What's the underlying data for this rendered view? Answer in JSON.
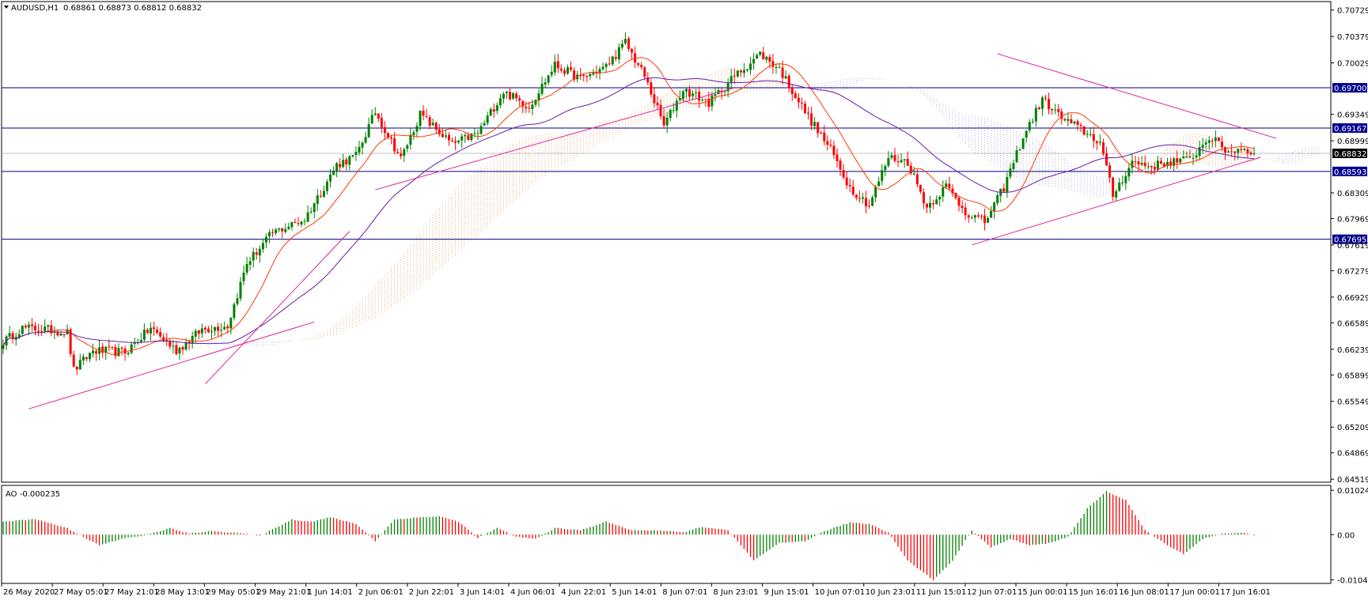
{
  "chart_data": [
    {
      "type": "candlestick",
      "symbol_label": "AUDUSD,H1",
      "ohlc_label": "0.68861 0.68873 0.68812 0.68832",
      "ylim": [
        0.645,
        0.7082
      ],
      "y_tick_labels": [
        {
          "value": 0.70729,
          "label": "0.70729"
        },
        {
          "value": 0.70379,
          "label": "0.70379"
        },
        {
          "value": 0.70029,
          "label": "0.70029"
        },
        {
          "value": 0.69349,
          "label": "0.69349"
        },
        {
          "value": 0.68999,
          "label": "0.68999"
        },
        {
          "value": 0.68309,
          "label": "0.68309"
        },
        {
          "value": 0.67969,
          "label": "0.67969"
        },
        {
          "value": 0.67619,
          "label": "0.67619"
        },
        {
          "value": 0.67279,
          "label": "0.67279"
        },
        {
          "value": 0.66929,
          "label": "0.66929"
        },
        {
          "value": 0.66589,
          "label": "0.66589"
        },
        {
          "value": 0.66239,
          "label": "0.66239"
        },
        {
          "value": 0.65899,
          "label": "0.65899"
        },
        {
          "value": 0.65549,
          "label": "0.65549"
        },
        {
          "value": 0.65209,
          "label": "0.65209"
        },
        {
          "value": 0.64869,
          "label": "0.64869"
        },
        {
          "value": 0.64519,
          "label": "0.64519"
        }
      ],
      "horizontal_levels": [
        {
          "value": 0.697,
          "label": "0.69700",
          "color": "#00008b"
        },
        {
          "value": 0.69167,
          "label": "0.69167",
          "color": "#00008b"
        },
        {
          "value": 0.68593,
          "label": "0.68593",
          "color": "#00008b"
        },
        {
          "value": 0.67695,
          "label": "0.67695",
          "color": "#00008b"
        }
      ],
      "current_price": {
        "value": 0.68832,
        "label": "0.68832"
      },
      "x_tick_labels": [
        "26 May 2020",
        "27 May 05:01",
        "27 May 21:01",
        "28 May 13:01",
        "29 May 05:01",
        "29 May 21:01",
        "1 Jun 14:01",
        "2 Jun 06:01",
        "2 Jun 22:01",
        "3 Jun 14:01",
        "4 Jun 06:01",
        "4 Jun 22:01",
        "5 Jun 14:01",
        "8 Jun 07:01",
        "8 Jun 23:01",
        "9 Jun 15:01",
        "10 Jun 07:01",
        "10 Jun 23:01",
        "11 Jun 15:01",
        "12 Jun 07:01",
        "15 Jun 00:01",
        "15 Jun 16:01",
        "16 Jun 08:01",
        "17 Jun 00:01",
        "17 Jun 16:01"
      ],
      "close_path": [
        {
          "bar": 0,
          "close": 0.6634
        },
        {
          "bar": 6,
          "close": 0.6652
        },
        {
          "bar": 14,
          "close": 0.665
        },
        {
          "bar": 20,
          "close": 0.6646
        },
        {
          "bar": 22,
          "close": 0.6596
        },
        {
          "bar": 28,
          "close": 0.6622
        },
        {
          "bar": 38,
          "close": 0.662
        },
        {
          "bar": 46,
          "close": 0.6652
        },
        {
          "bar": 54,
          "close": 0.6622
        },
        {
          "bar": 62,
          "close": 0.665
        },
        {
          "bar": 70,
          "close": 0.6655
        },
        {
          "bar": 76,
          "close": 0.6738
        },
        {
          "bar": 84,
          "close": 0.6778
        },
        {
          "bar": 94,
          "close": 0.6796
        },
        {
          "bar": 104,
          "close": 0.6868
        },
        {
          "bar": 110,
          "close": 0.688
        },
        {
          "bar": 116,
          "close": 0.6938
        },
        {
          "bar": 124,
          "close": 0.6876
        },
        {
          "bar": 130,
          "close": 0.6935
        },
        {
          "bar": 140,
          "close": 0.6895
        },
        {
          "bar": 148,
          "close": 0.691
        },
        {
          "bar": 156,
          "close": 0.6965
        },
        {
          "bar": 164,
          "close": 0.6945
        },
        {
          "bar": 172,
          "close": 0.7
        },
        {
          "bar": 180,
          "close": 0.6982
        },
        {
          "bar": 188,
          "close": 0.6998
        },
        {
          "bar": 194,
          "close": 0.703
        },
        {
          "bar": 200,
          "close": 0.6985
        },
        {
          "bar": 206,
          "close": 0.692
        },
        {
          "bar": 212,
          "close": 0.6968
        },
        {
          "bar": 220,
          "close": 0.695
        },
        {
          "bar": 228,
          "close": 0.6985
        },
        {
          "bar": 236,
          "close": 0.7015
        },
        {
          "bar": 242,
          "close": 0.6995
        },
        {
          "bar": 250,
          "close": 0.6938
        },
        {
          "bar": 258,
          "close": 0.6888
        },
        {
          "bar": 264,
          "close": 0.6838
        },
        {
          "bar": 270,
          "close": 0.6815
        },
        {
          "bar": 276,
          "close": 0.6878
        },
        {
          "bar": 282,
          "close": 0.6872
        },
        {
          "bar": 288,
          "close": 0.6812
        },
        {
          "bar": 294,
          "close": 0.684
        },
        {
          "bar": 300,
          "close": 0.6806
        },
        {
          "bar": 306,
          "close": 0.6792
        },
        {
          "bar": 312,
          "close": 0.6838
        },
        {
          "bar": 318,
          "close": 0.6905
        },
        {
          "bar": 324,
          "close": 0.6955
        },
        {
          "bar": 330,
          "close": 0.693
        },
        {
          "bar": 336,
          "close": 0.6915
        },
        {
          "bar": 342,
          "close": 0.6898
        },
        {
          "bar": 346,
          "close": 0.6828
        },
        {
          "bar": 352,
          "close": 0.6872
        },
        {
          "bar": 358,
          "close": 0.6866
        },
        {
          "bar": 364,
          "close": 0.6872
        },
        {
          "bar": 370,
          "close": 0.6875
        },
        {
          "bar": 376,
          "close": 0.6905
        },
        {
          "bar": 382,
          "close": 0.6885
        },
        {
          "bar": 386,
          "close": 0.689
        },
        {
          "bar": 390,
          "close": 0.6883
        }
      ]
    },
    {
      "type": "bar",
      "label": "AO -0.000235",
      "ylim": [
        -0.0109,
        0.011
      ],
      "y_tick_labels": [
        {
          "value": 0.010241,
          "label": "0.010241"
        },
        {
          "value": 0.0,
          "label": "0.00"
        },
        {
          "value": -0.010443,
          "label": "-0.010443"
        }
      ],
      "ao_path": [
        {
          "bar": 0,
          "value": 0.003
        },
        {
          "bar": 10,
          "value": 0.0036
        },
        {
          "bar": 20,
          "value": 0.0015
        },
        {
          "bar": 30,
          "value": -0.0025
        },
        {
          "bar": 38,
          "value": -0.0008
        },
        {
          "bar": 44,
          "value": -0.0002
        },
        {
          "bar": 52,
          "value": 0.0015
        },
        {
          "bar": 58,
          "value": 0.0002
        },
        {
          "bar": 64,
          "value": 0.0008
        },
        {
          "bar": 72,
          "value": 0.0005
        },
        {
          "bar": 80,
          "value": -0.0003
        },
        {
          "bar": 90,
          "value": 0.0035
        },
        {
          "bar": 96,
          "value": 0.003
        },
        {
          "bar": 102,
          "value": 0.004
        },
        {
          "bar": 110,
          "value": 0.0025
        },
        {
          "bar": 116,
          "value": -0.0015
        },
        {
          "bar": 122,
          "value": 0.0035
        },
        {
          "bar": 130,
          "value": 0.004
        },
        {
          "bar": 136,
          "value": 0.0042
        },
        {
          "bar": 142,
          "value": 0.003
        },
        {
          "bar": 148,
          "value": -0.0008
        },
        {
          "bar": 154,
          "value": 0.0015
        },
        {
          "bar": 160,
          "value": -0.0005
        },
        {
          "bar": 166,
          "value": -0.001
        },
        {
          "bar": 172,
          "value": 0.0015
        },
        {
          "bar": 180,
          "value": 0.001
        },
        {
          "bar": 188,
          "value": 0.003
        },
        {
          "bar": 196,
          "value": 0.001
        },
        {
          "bar": 204,
          "value": 0.001
        },
        {
          "bar": 212,
          "value": 0.0005
        },
        {
          "bar": 218,
          "value": 0.0018
        },
        {
          "bar": 226,
          "value": 0.001
        },
        {
          "bar": 234,
          "value": -0.006
        },
        {
          "bar": 242,
          "value": -0.002
        },
        {
          "bar": 250,
          "value": -0.0015
        },
        {
          "bar": 256,
          "value": 0.0008
        },
        {
          "bar": 264,
          "value": 0.0028
        },
        {
          "bar": 270,
          "value": 0.0025
        },
        {
          "bar": 276,
          "value": 0.0005
        },
        {
          "bar": 282,
          "value": -0.006
        },
        {
          "bar": 290,
          "value": -0.0105
        },
        {
          "bar": 296,
          "value": -0.006
        },
        {
          "bar": 302,
          "value": 0.001
        },
        {
          "bar": 308,
          "value": -0.003
        },
        {
          "bar": 314,
          "value": -0.001
        },
        {
          "bar": 320,
          "value": -0.0025
        },
        {
          "bar": 326,
          "value": -0.002
        },
        {
          "bar": 332,
          "value": -0.0005
        },
        {
          "bar": 338,
          "value": 0.006
        },
        {
          "bar": 344,
          "value": 0.01
        },
        {
          "bar": 350,
          "value": 0.008
        },
        {
          "bar": 356,
          "value": 0.001
        },
        {
          "bar": 362,
          "value": -0.002
        },
        {
          "bar": 368,
          "value": -0.0045
        },
        {
          "bar": 374,
          "value": -0.001
        },
        {
          "bar": 380,
          "value": 0.0002
        },
        {
          "bar": 386,
          "value": 0.0005
        },
        {
          "bar": 390,
          "value": -0.0002
        }
      ]
    }
  ],
  "colors": {
    "bull": "#008000",
    "bear": "#ff0000",
    "level": "#00008b",
    "ma_fast": "#ff3a00",
    "ma_slow": "#6a1aa8",
    "trendline": "#e0239a",
    "cloud": "#e8a670",
    "cloud_alt": "#b4a6d8",
    "grid": "#c8c8c8",
    "axis": "#000000"
  },
  "indicators": [
    "moving-average-fast",
    "moving-average-slow",
    "ichimoku-cloud",
    "trendlines"
  ]
}
